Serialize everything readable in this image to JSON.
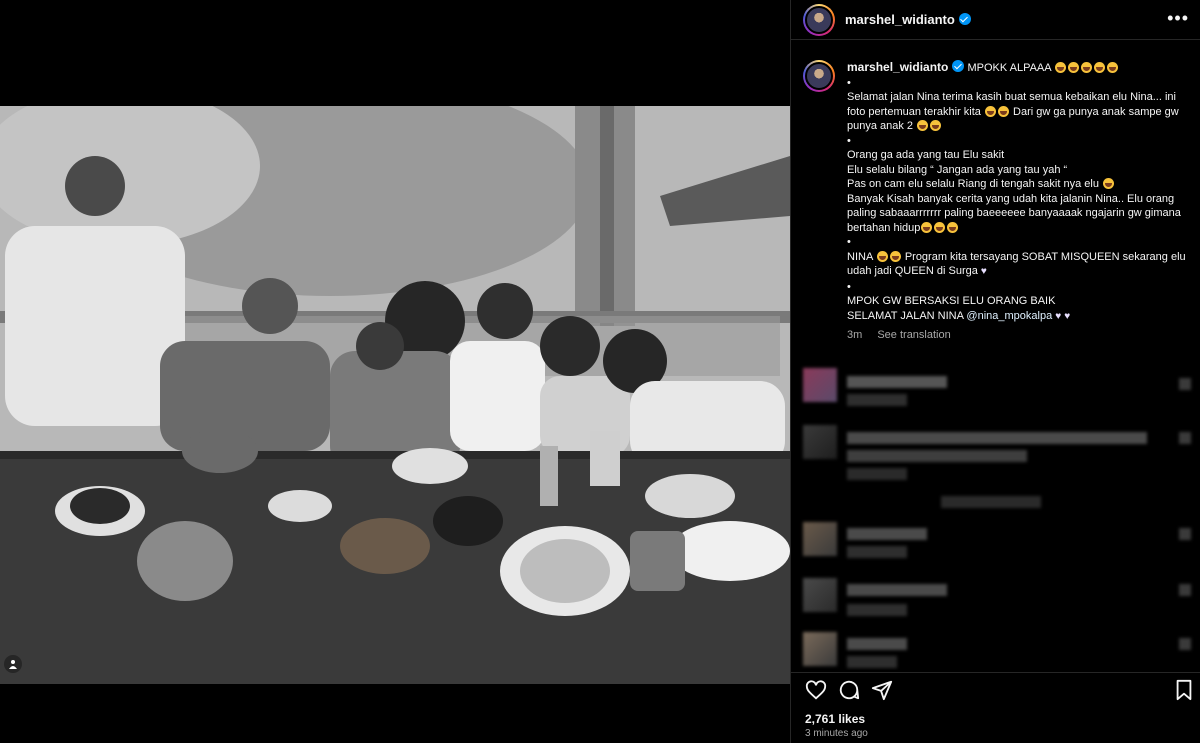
{
  "post": {
    "username": "marshel_widianto",
    "photo_description_icon": "person-tag-icon"
  },
  "caption": {
    "username": "marshel_widianto",
    "line1": "MPOKK ALPAAA",
    "bullet": "•",
    "para1": "Selamat jalan Nina terima kasih buat semua kebaikan elu Nina... ini foto pertemuan terakhir kita",
    "para1b": "Dari gw ga punya anak sampe gw punya anak 2",
    "para2_l1": "Orang ga ada yang tau Elu sakit",
    "para2_l2": "Elu selalu bilang “ Jangan ada yang tau yah “",
    "para2_l3": "Pas on cam elu selalu Riang di tengah sakit nya elu",
    "para2_l4": "Banyak Kisah banyak cerita yang udah kita jalanin Nina.. Elu orang paling sabaaarrrrrrr paling baeeeeee banyaaaak ngajarin gw gimana bertahan hidup",
    "para3_a": "NINA",
    "para3_b": "Program kita tersayang SOBAT MISQUEEN sekarang elu udah jadi QUEEN di Surga",
    "para4_l1": "MPOK GW BERSAKSI ELU ORANG BAIK",
    "para4_l2": "SELAMAT JALAN NINA",
    "mention": "@nina_mpokalpa",
    "age": "3m",
    "see_translation": "See translation"
  },
  "footer": {
    "likes": "2,761 likes",
    "time": "3 minutes ago"
  },
  "colors": {
    "background": "#000000",
    "verified": "#0095f6",
    "muted": "#a8a8a8",
    "divider": "#262626"
  }
}
